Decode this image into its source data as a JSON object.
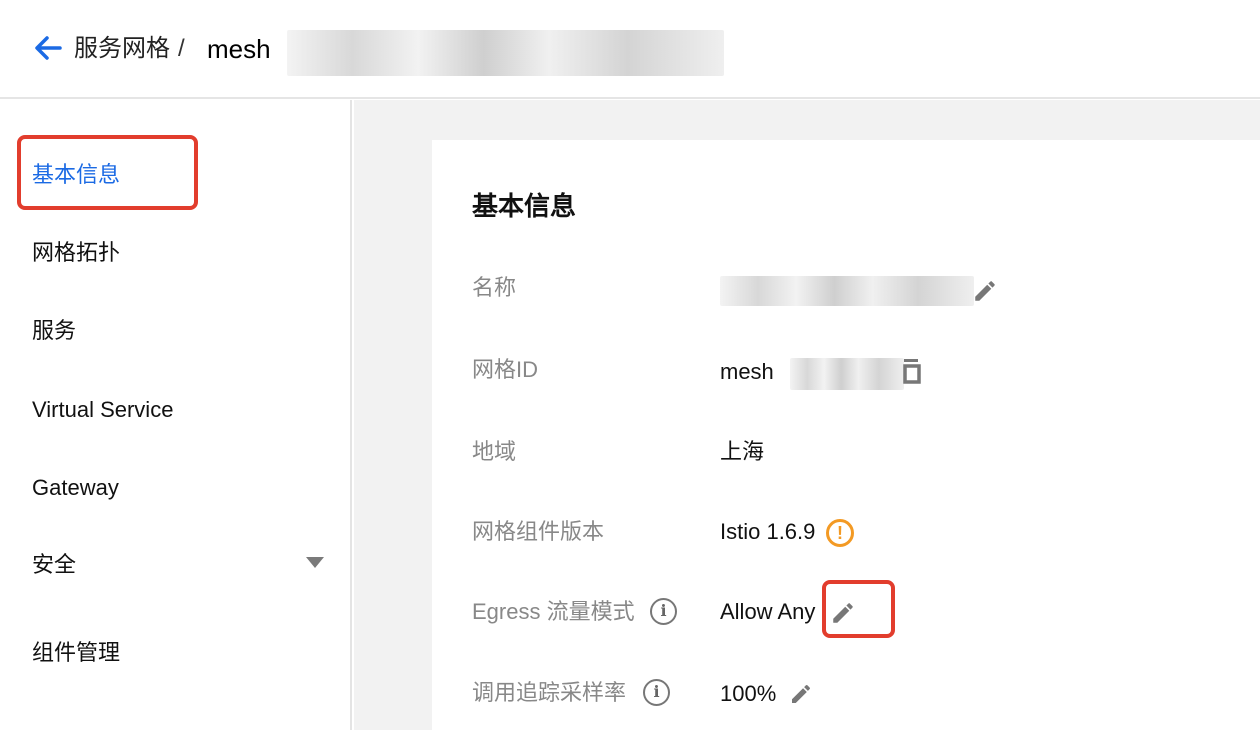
{
  "breadcrumb": {
    "parent": "服务网格",
    "separator": "/",
    "current": "mesh"
  },
  "sidebar": {
    "items": [
      {
        "label": "基本信息",
        "active": true
      },
      {
        "label": "网格拓扑"
      },
      {
        "label": "服务"
      },
      {
        "label": "Virtual Service"
      },
      {
        "label": "Gateway"
      },
      {
        "label": "安全",
        "has_dropdown": true
      },
      {
        "label": "组件管理"
      }
    ]
  },
  "card": {
    "title": "基本信息",
    "fields": [
      {
        "label": "名称",
        "value": ""
      },
      {
        "label": "网格ID",
        "value": "mesh"
      },
      {
        "label": "地域",
        "value": "上海"
      },
      {
        "label": "网格组件版本",
        "value": "Istio 1.6.9"
      },
      {
        "label": "Egress 流量模式",
        "value": "Allow Any"
      },
      {
        "label": "调用追踪采样率",
        "value": "100%"
      }
    ]
  },
  "icons": {
    "back": "arrow-left-icon",
    "edit": "pencil-icon",
    "copy": "copy-icon",
    "info": "info-circle-icon",
    "warning": "warning-circle-icon",
    "dropdown": "chevron-down-icon"
  },
  "colors": {
    "accent": "#1b6ae4",
    "highlight": "#e23d2d",
    "warning": "#f39a24"
  }
}
